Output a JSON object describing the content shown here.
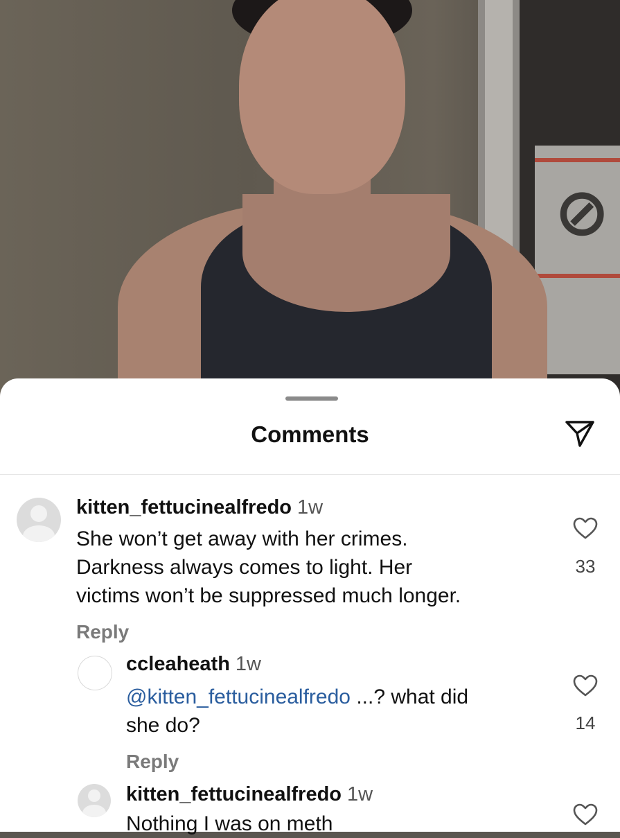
{
  "sheet": {
    "title": "Comments"
  },
  "comments": [
    {
      "username": "kitten_fettucinealfredo",
      "time": "1w",
      "lines": [
        "She won’t get away with her crimes.",
        "Darkness always comes to light. Her",
        "victims won’t be suppressed much longer."
      ],
      "reply_label": "Reply",
      "likes": "33"
    },
    {
      "username": "ccleaheath",
      "time": "1w",
      "mention": "@kitten_fettucinealfredo",
      "line1_rest": " ...? what did",
      "line2": "she do?",
      "reply_label": "Reply",
      "likes": "14"
    },
    {
      "username": "kitten_fettucinealfredo",
      "time": "1w",
      "line1": "Nothing I was on meth"
    }
  ],
  "icons": {
    "share": "paper-plane-icon",
    "like": "heart-icon",
    "avatar": "default-avatar-icon"
  },
  "colors": {
    "mention": "#2a5d9e",
    "reply": "#7a7a7a",
    "sheet": "#ffffff"
  }
}
